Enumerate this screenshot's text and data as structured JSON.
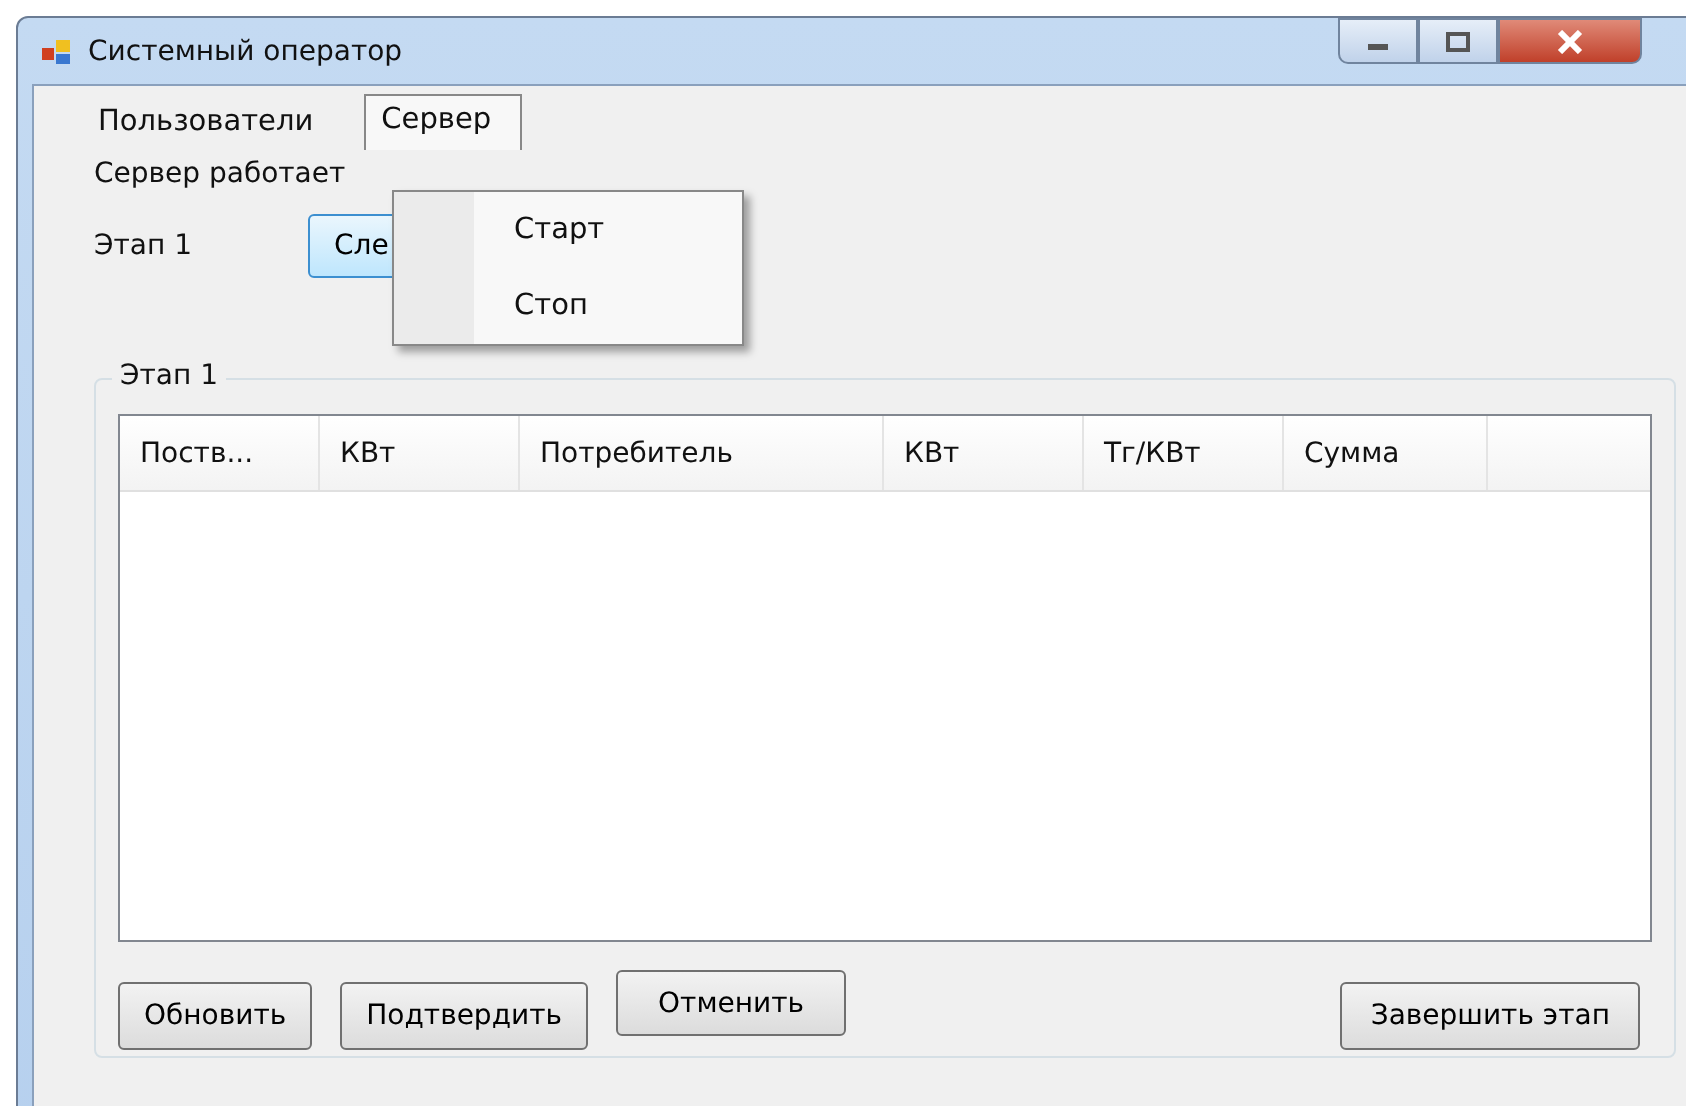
{
  "window": {
    "title": "Системный оператор"
  },
  "menu": [
    {
      "label": "Пользователи",
      "selected": false
    },
    {
      "label": "Сервер",
      "selected": true
    }
  ],
  "dropdown": [
    "Старт",
    "Стоп"
  ],
  "status": "Сервер работает",
  "stage_label": "Этап 1",
  "stage_button": "Сле",
  "group": {
    "title": "Этап 1"
  },
  "table": {
    "columns": [
      "Поств...",
      "КВт",
      "Потребитель",
      "КВт",
      "Тг/КВт",
      "Сумма"
    ]
  },
  "buttons": [
    {
      "label": "Обновить",
      "kind": "left"
    },
    {
      "label": "Подтвердить",
      "kind": "left"
    },
    {
      "label": "Отменить",
      "kind": "raised"
    },
    {
      "label": "Завершить этап",
      "kind": "right"
    }
  ]
}
